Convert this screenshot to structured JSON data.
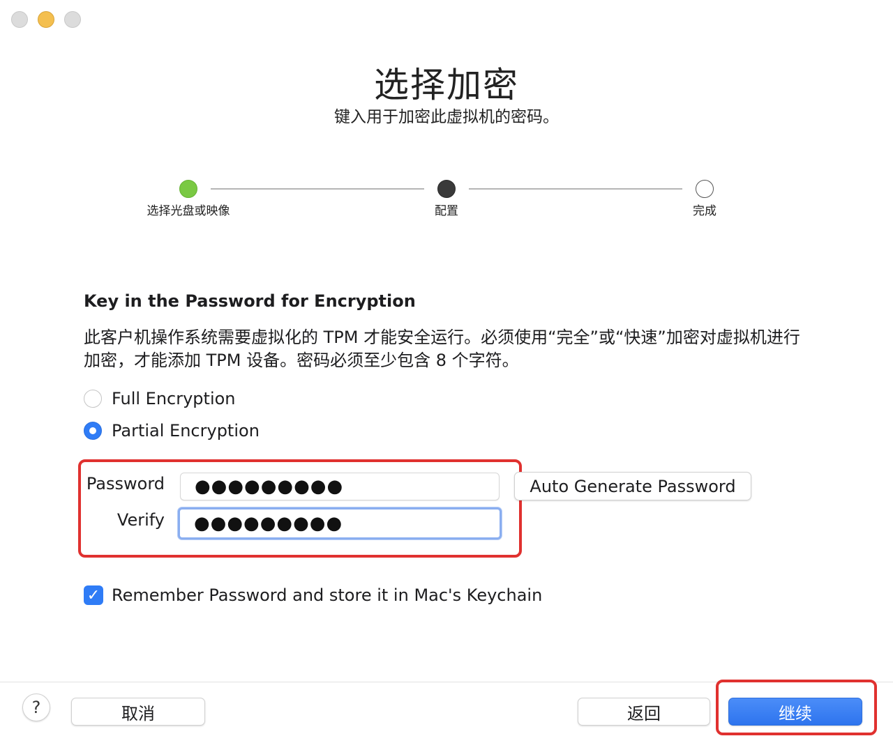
{
  "window": {
    "title": "选择加密",
    "subtitle": "键入用于加密此虚拟机的密码。"
  },
  "steps": [
    {
      "label": "选择光盘或映像",
      "status": "done",
      "color": "#7ac943"
    },
    {
      "label": "配置",
      "status": "current",
      "color": "#3a3a3a"
    },
    {
      "label": "完成",
      "status": "pending",
      "color": "#ffffff"
    }
  ],
  "section": {
    "heading": "Key in the Password for Encryption",
    "description": "此客户机操作系统需要虚拟化的 TPM 才能安全运行。必须使用“完全”或“快速”加密对虚拟机进行加密，才能添加 TPM 设备。密码必须至少包含 8 个字符。"
  },
  "encryption": {
    "options": [
      {
        "label": "Full Encryption",
        "selected": false
      },
      {
        "label": "Partial Encryption",
        "selected": true
      }
    ]
  },
  "password": {
    "password_label": "Password",
    "password_value": "●●●●●●●●●",
    "verify_label": "Verify",
    "verify_value": "●●●●●●●●●",
    "auto_generate_label": "Auto Generate Password"
  },
  "keychain": {
    "label": "Remember Password and store it in Mac's Keychain",
    "checked": true
  },
  "footer": {
    "help": "?",
    "cancel": "取消",
    "back": "返回",
    "continue": "继续"
  },
  "colors": {
    "accent": "#3b82f6",
    "highlight": "#e0312f"
  }
}
